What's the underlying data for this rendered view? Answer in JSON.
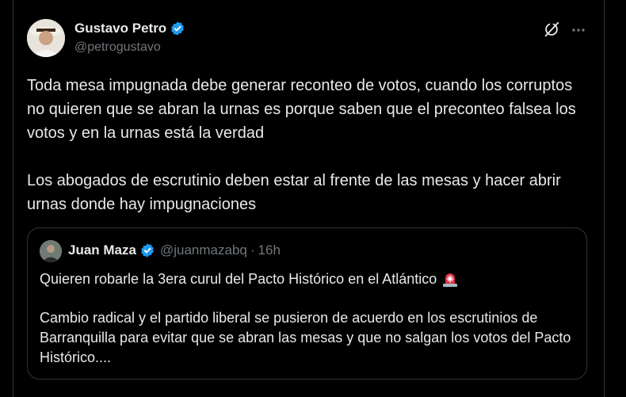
{
  "tweet": {
    "author_name": "Gustavo Petro",
    "author_handle": "@petrogustavo",
    "text": "Toda mesa impugnada debe generar reconteo de votos, cuando los corruptos no quieren que se abran la urnas es porque saben que el preconteo falsea los votos y en la urnas está la verdad\n\nLos abogados de escrutinio deben estar al frente de las mesas y hacer abrir urnas donde hay impugnaciones"
  },
  "quoted_tweet": {
    "author_name": "Juan Maza",
    "author_handle": "@juanmazabq",
    "separator": "·",
    "time": "16h",
    "line1": "Quieren robarle la 3era curul del Pacto Histórico en el Atlántico",
    "body": "Cambio radical y el partido liberal se pusieron de acuerdo en los escrutinios de Barranquilla para evitar que se abran las mesas y que no salgan los votos del Pacto Histórico...."
  },
  "icons": {
    "verified": "verified-badge-icon",
    "grok": "grok-icon",
    "more": "more-options-icon",
    "siren": "police-siren-emoji-icon"
  },
  "colors": {
    "background": "#000000",
    "text_primary": "#e7e9ea",
    "text_secondary": "#71767b",
    "border": "#2f3336",
    "verified_blue": "#1d9bf0"
  }
}
